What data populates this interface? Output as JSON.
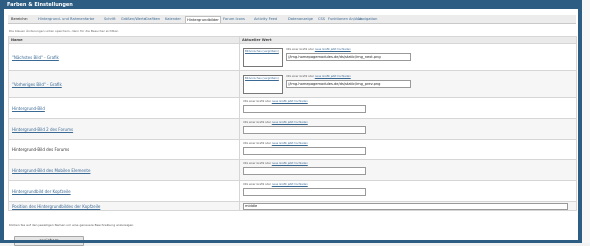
{
  "header": {
    "title": "Farben & Einstellungen"
  },
  "tabs": [
    {
      "label": "Bereiche:",
      "active": false,
      "first": true
    },
    {
      "label": "Hintergrund- und Rahmenfarbe",
      "active": false
    },
    {
      "label": "Schrift",
      "active": false
    },
    {
      "label": "Größen/Werte",
      "active": false
    },
    {
      "label": "Grafiken",
      "active": false
    },
    {
      "label": "Kalender",
      "active": false
    },
    {
      "label": "Hintergrundbilder",
      "active": true
    },
    {
      "label": "Forum Icons",
      "active": false
    },
    {
      "label": "Activity Feed",
      "active": false
    },
    {
      "label": "Datenanzeige",
      "active": false
    },
    {
      "label": "CSS",
      "active": false
    },
    {
      "label": "Funktionen An/Aus",
      "active": false
    },
    {
      "label": "Navigation",
      "active": false
    }
  ],
  "hint": "Die blauen Änderungen unten speichern, dann für die Besucher sichtbar.",
  "table": {
    "col_name": "Name",
    "col_value": "Aktueller Wert",
    "preview_link": "Bildvorschau (vergrößern)",
    "url_hint": "URL einer Grafik oder",
    "url_hint_link": "neue Grafik jetzt hochladen",
    "rows": [
      {
        "label": "\"Nächstes Bild\" - Grafik",
        "link": true,
        "preview": true,
        "value": "//img.homepagemodules.de/ds/static/img_next.png"
      },
      {
        "label": "\"Vorheriges Bild\" - Grafik",
        "link": true,
        "preview": true,
        "value": "//img.homepagemodules.de/ds/static/img_prev.png"
      },
      {
        "label": "Hintergrund-Bild",
        "link": true,
        "preview": false,
        "value": ""
      },
      {
        "label": "Hintergrund-Bild 2 des Forums",
        "link": true,
        "preview": false,
        "value": ""
      },
      {
        "label": "Hintergrund-Bild des Forums",
        "link": false,
        "preview": false,
        "value": ""
      },
      {
        "label": "Hintergrund-Bild des Mobilen Elemente",
        "link": true,
        "preview": false,
        "value": ""
      },
      {
        "label": "Hintergrundbild der Kopfzeile",
        "link": true,
        "preview": false,
        "value": ""
      },
      {
        "label": "Position des Hintergrundbildes der Kopfzeile",
        "link": true,
        "preview": false,
        "value": "middle",
        "wide": true
      }
    ]
  },
  "footer_hint": "Klicken Sie auf den jeweiligen Namen um eine genauere Beschreibung anzuzeigen.",
  "save_label": "speichern"
}
